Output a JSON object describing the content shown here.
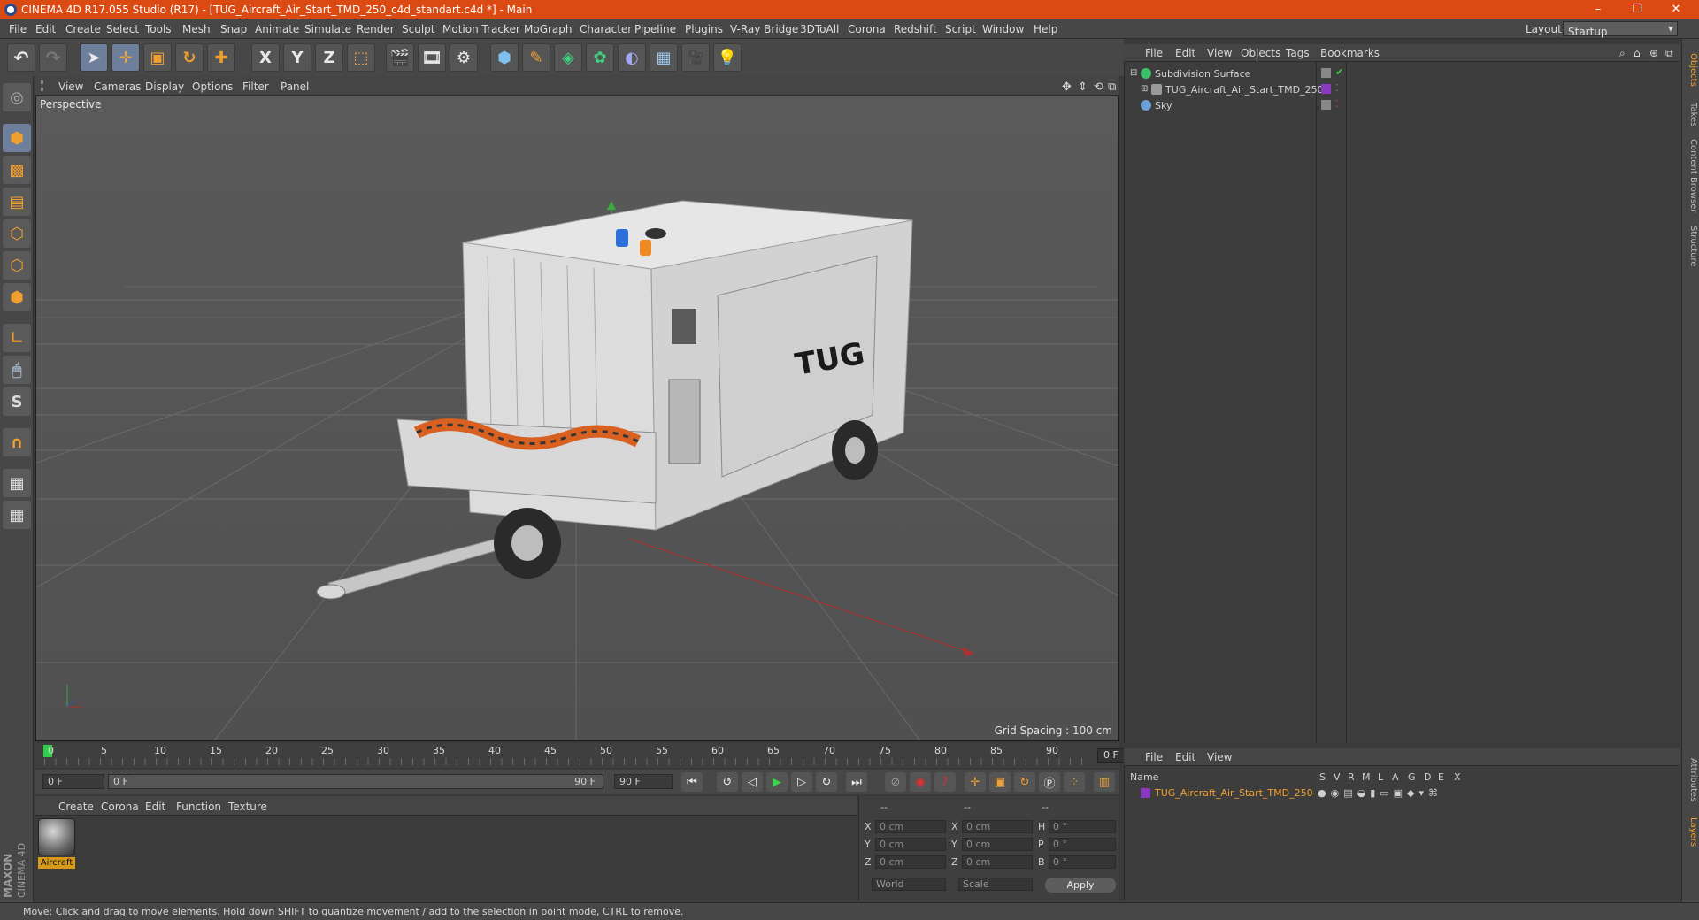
{
  "titlebar": {
    "title": "CINEMA 4D R17.055 Studio (R17) - [TUG_Aircraft_Air_Start_TMD_250_c4d_standart.c4d *] - Main",
    "minimize": "–",
    "maximize": "❐",
    "close": "✕"
  },
  "menubar": {
    "items": [
      "File",
      "Edit",
      "Create",
      "Select",
      "Tools",
      "Mesh",
      "Snap",
      "Animate",
      "Simulate",
      "Render",
      "Sculpt",
      "Motion Tracker",
      "MoGraph",
      "Character",
      "Pipeline",
      "Plugins",
      "V-Ray Bridge",
      "3DToAll",
      "Corona",
      "Redshift",
      "Script",
      "Window",
      "Help"
    ],
    "layout_label": "Layout:",
    "layout_value": "Startup"
  },
  "toolbar": {
    "icons": [
      "undo-icon",
      "redo-icon",
      "select-cursor-icon",
      "move-icon",
      "scale-icon",
      "rotate-icon",
      "live-select-icon",
      "x-axis-icon",
      "y-axis-icon",
      "z-axis-icon",
      "coordinate-system-icon",
      "render-view-icon",
      "render-picture-viewer-icon",
      "edit-render-settings-icon",
      "cube-primitive-icon",
      "pen-spline-icon",
      "subdivision-icon",
      "array-icon",
      "deformer-icon",
      "floor-icon",
      "camera-icon",
      "light-icon"
    ],
    "x_label": "X",
    "y_label": "Y",
    "z_label": "Z"
  },
  "viewport": {
    "menu": [
      "View",
      "Cameras",
      "Display",
      "Options",
      "Filter",
      "Panel"
    ],
    "label": "Perspective",
    "grid_spacing": "Grid Spacing : 100 cm",
    "model_logo": "TUG"
  },
  "timeline": {
    "ticks": [
      "0",
      "5",
      "10",
      "15",
      "20",
      "25",
      "30",
      "35",
      "40",
      "45",
      "50",
      "55",
      "60",
      "65",
      "70",
      "75",
      "80",
      "85",
      "90"
    ],
    "current_frame": "0 F"
  },
  "transport": {
    "start": "0 F",
    "range_start": "0 F",
    "range_end": "90 F",
    "end": "90 F"
  },
  "material_manager": {
    "menu": [
      "Create",
      "Corona",
      "Edit",
      "Function",
      "Texture"
    ],
    "material_name": "Aircraft"
  },
  "coordinates": {
    "header": [
      "--",
      "--",
      "--"
    ],
    "rows": [
      {
        "a": "X",
        "av": "0 cm",
        "b": "X",
        "bv": "0 cm",
        "c": "H",
        "cv": "0 °"
      },
      {
        "a": "Y",
        "av": "0 cm",
        "b": "Y",
        "bv": "0 cm",
        "c": "P",
        "cv": "0 °"
      },
      {
        "a": "Z",
        "av": "0 cm",
        "b": "Z",
        "bv": "0 cm",
        "c": "B",
        "cv": "0 °"
      }
    ],
    "mode1": "World",
    "mode2": "Scale",
    "apply": "Apply"
  },
  "object_manager": {
    "menu": [
      "File",
      "Edit",
      "View",
      "Objects",
      "Tags",
      "Bookmarks"
    ],
    "objects": [
      {
        "name": "Subdivision Surface",
        "icon_color": "#3cc06a"
      },
      {
        "name": "TUG_Aircraft_Air_Start_TMD_250",
        "icon_color": "#9a9a9a"
      },
      {
        "name": "Sky",
        "icon_color": "#6ea0d8"
      }
    ],
    "tag_color": "#8a3ac0"
  },
  "layer_manager": {
    "menu": [
      "File",
      "Edit",
      "View"
    ],
    "columns": [
      "Name",
      "S",
      "V",
      "R",
      "M",
      "L",
      "A",
      "G",
      "D",
      "E",
      "X"
    ],
    "layer_name": "TUG_Aircraft_Air_Start_TMD_250",
    "layer_color": "#8a3ac0"
  },
  "side_tabs": [
    "Objects",
    "Takes",
    "Content Browser",
    "Structure",
    "Attributes",
    "Layers"
  ],
  "status": "Move: Click and drag to move elements. Hold down SHIFT to quantize movement / add to the selection in point mode, CTRL to remove.",
  "brand": {
    "line1": "MAXON",
    "line2": "CINEMA 4D"
  }
}
